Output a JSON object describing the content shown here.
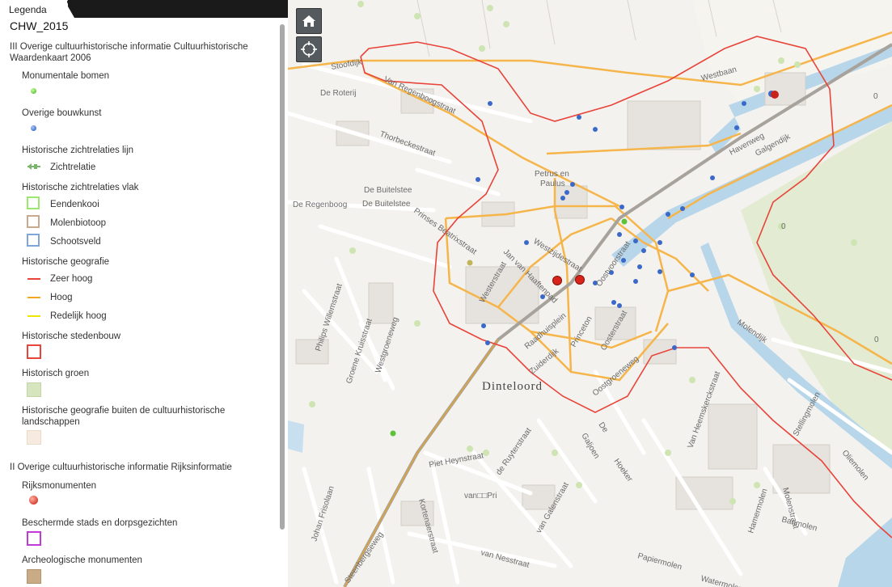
{
  "legend": {
    "tab_label": "Legenda",
    "layer_title": "CHW_2015",
    "group1_title": "III Overige cultuurhistorische informatie Cultuurhistorische Waardenkaart 2006",
    "items": {
      "monumentale_bomen": "Monumentale bomen",
      "overige_bouwkunst": "Overige bouwkunst",
      "zichtrelaties_lijn": "Historische zichtrelaties lijn",
      "zichtrelatie": "Zichtrelatie",
      "zichtrelaties_vlak": "Historische zichtrelaties vlak",
      "eendenkooi": "Eendenkooi",
      "molenbiotoop": "Molenbiotoop",
      "schootsveld": "Schootsveld",
      "historische_geografie": "Historische geografie",
      "zeer_hoog": "Zeer hoog",
      "hoog": "Hoog",
      "redelijk_hoog": "Redelijk hoog",
      "historische_stedenbouw": "Historische stedenbouw",
      "historisch_groen": "Historisch groen",
      "geografie_buiten": "Historische geografie buiten de cultuurhistorische landschappen"
    },
    "group2_title": "II Overige cultuurhistorische informatie Rijksinformatie",
    "items2": {
      "rijksmonumenten": "Rijksmonumenten",
      "beschermde": "Beschermde stads en dorpsgezichten",
      "archeologische": "Archeologische monumenten"
    },
    "colors": {
      "zeer_hoog": "#e8443a",
      "hoog": "#f5a623",
      "redelijk_hoog": "#f2e600",
      "stedenbouw": "#e8443a",
      "groen_fill": "#d6e5bd",
      "buiten_fill": "#f7ebe0",
      "eendenkooi": "#9be86e",
      "molenbiotoop": "#c9a98e",
      "schootsveld": "#7fa6d9",
      "beschermde": "#c03ad8",
      "archeologische": "#c9ac86"
    }
  },
  "map": {
    "labels": {
      "stoofdijk": "Stoofdijk",
      "regenboogstraat": "Van Regenboogstraat",
      "de_roterij": "De Roterij",
      "thorbeckestraat": "Thorbeckestraat",
      "petrus_en_paulus_1": "Petrus en",
      "petrus_en_paulus_2": "Paulus",
      "de_buitelstee_1": "De Buitelstee",
      "de_buitelstee_2": "De Buitelstee",
      "de_regenboog": "De Regenboog",
      "prinses_beatrixstraat": "Prinses Beatrixstraat",
      "westerstraat": "Westerstraat",
      "westzijdestraat": "Westzijdestraat",
      "jan_van_haaftenpad": "Jan van Haaftenpad",
      "oostvoorstraat": "Oostvoorstraat",
      "raadhuisplein": "Raadhuisplein",
      "princeton": "Princeton",
      "oosterstraat": "Oosterstraat",
      "zuiderdijk": "Zuiderdijk",
      "oostgroeneweg": "Oostgroeneweg",
      "dinteloord": "Dinteloord",
      "philips_willemstraat": "Philips Willemstraat",
      "groene_kruisstraat": "Groene Kruisstraat",
      "westgroeneweg": "Westgroeneweg",
      "havenweg": "Havenweg",
      "galgendijk": "Galgendijk",
      "westbaan": "Westbaan",
      "molendijk": "Molendijk",
      "van_heemskerckstraat": "Van Heemskerckstraat",
      "stellingmolen": "Stellingmolen",
      "oliemolen": "Oliemolen",
      "galjoen": "Galjoen",
      "hoeker": "Hoeker",
      "de_ruyterstraat": "de Ruyterstraat",
      "piet_heynstraat": "Piet Heynstraat",
      "van_pri": "van□□Pri",
      "van_galenstraat": "van Galenstraat",
      "johan_frisolaan": "Johan Frisolaan",
      "kortenaerstraat": "Kortenaerstraat",
      "van_nesstraat": "van Nesstraat",
      "papiermolen": "Papiermolen",
      "banmolen": "Banmolen",
      "hamermolen": "Hamermolen",
      "molenstraat": "Molenstraat",
      "watermolen": "Watermolen",
      "steenbergseweg": "Steenbergseweg",
      "de": "De",
      "zero_a": "0",
      "zero_b": "0",
      "zero_c": "0"
    }
  }
}
